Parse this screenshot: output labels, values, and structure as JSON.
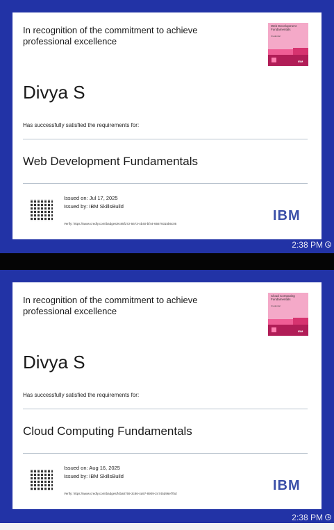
{
  "messages": [
    {
      "certificate": {
        "recognition": "In recognition of the commitment to achieve professional excellence",
        "recipient": "Divya S",
        "satisfied_text": "Has successfully satisfied the requirements for:",
        "course": "Web Development Fundamentals",
        "issued_on": "Issued on: Jul 17, 2025",
        "issued_by": "Issued by:  IBM SkillsBuild",
        "verify": "Verify:   https://www.credly.com/badges/ec85f372-5673-4b40-bf44-65679315b6c05",
        "logo": "IBM",
        "badge": {
          "title": "Web Development Fundamentals",
          "subtitle": "Credential",
          "logo": "IBM",
          "color": "#f4a9c8"
        }
      },
      "time": "2:38 PM"
    },
    {
      "certificate": {
        "recognition": "In recognition of the commitment to achieve professional excellence",
        "recipient": "Divya S",
        "satisfied_text": "Has successfully satisfied the requirements for:",
        "course": "Cloud Computing Fundamentals",
        "issued_on": "Issued on: Aug 16, 2025",
        "issued_by": "Issued by:  IBM SkillsBuild",
        "verify": "Verify:   https://www.credly.com/badges/f4ba8759-3c86-4a97-8909-24745d96ef7bd",
        "logo": "IBM",
        "badge": {
          "title": "Cloud Computing Fundamentals",
          "subtitle": "Credential",
          "logo": "IBM",
          "color": "#f4a9c8"
        }
      },
      "time": "2:38 PM"
    }
  ],
  "colors": {
    "chat_bubble": "#2233a6",
    "ibm_blue": "#3a4fa8",
    "badge_pink": "#f4a9c8"
  },
  "icons": {
    "time_status": "clock-icon"
  }
}
